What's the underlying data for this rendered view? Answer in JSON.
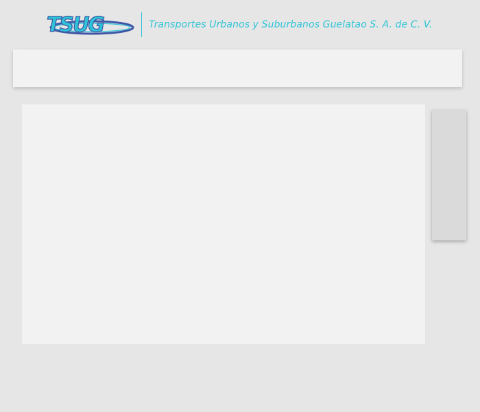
{
  "header": {
    "logo": {
      "name": "tsug-logo",
      "wordmark": "TSUG",
      "primary_color": "#2ec4d6",
      "secondary_color": "#3d56a6"
    },
    "company_name": "Transportes Urbanos y Suburbanos Guelatao S. A. de C. V."
  },
  "colors": {
    "accent": "#2ec4d6",
    "logo_blue": "#3d56a6",
    "page_background": "#e6e6e6",
    "panel_background": "#f2f2f2",
    "side_panel_background": "#dadada"
  }
}
